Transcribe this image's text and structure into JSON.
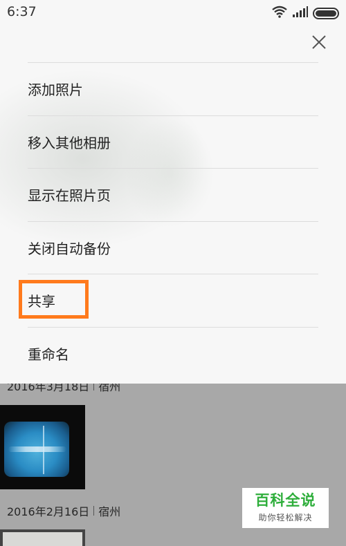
{
  "status_bar": {
    "time": "6:37",
    "icons": [
      "wifi-icon",
      "signal-icon",
      "battery-icon"
    ]
  },
  "menu": {
    "items": [
      {
        "label": "添加照片"
      },
      {
        "label": "移入其他相册"
      },
      {
        "label": "显示在照片页"
      },
      {
        "label": "关闭自动备份"
      },
      {
        "label": "共享",
        "highlighted": true
      },
      {
        "label": "重命名"
      }
    ],
    "close_icon": "close-icon",
    "highlight_color": "#ff7a1c"
  },
  "gallery": {
    "groups": [
      {
        "date": "2016年3月18日",
        "location": "宿州"
      },
      {
        "date": "2016年2月16日",
        "location": "宿州"
      }
    ]
  },
  "watermark": {
    "title": "百科全说",
    "subtitle": "助你轻松解决",
    "color": "#2eae3b"
  }
}
